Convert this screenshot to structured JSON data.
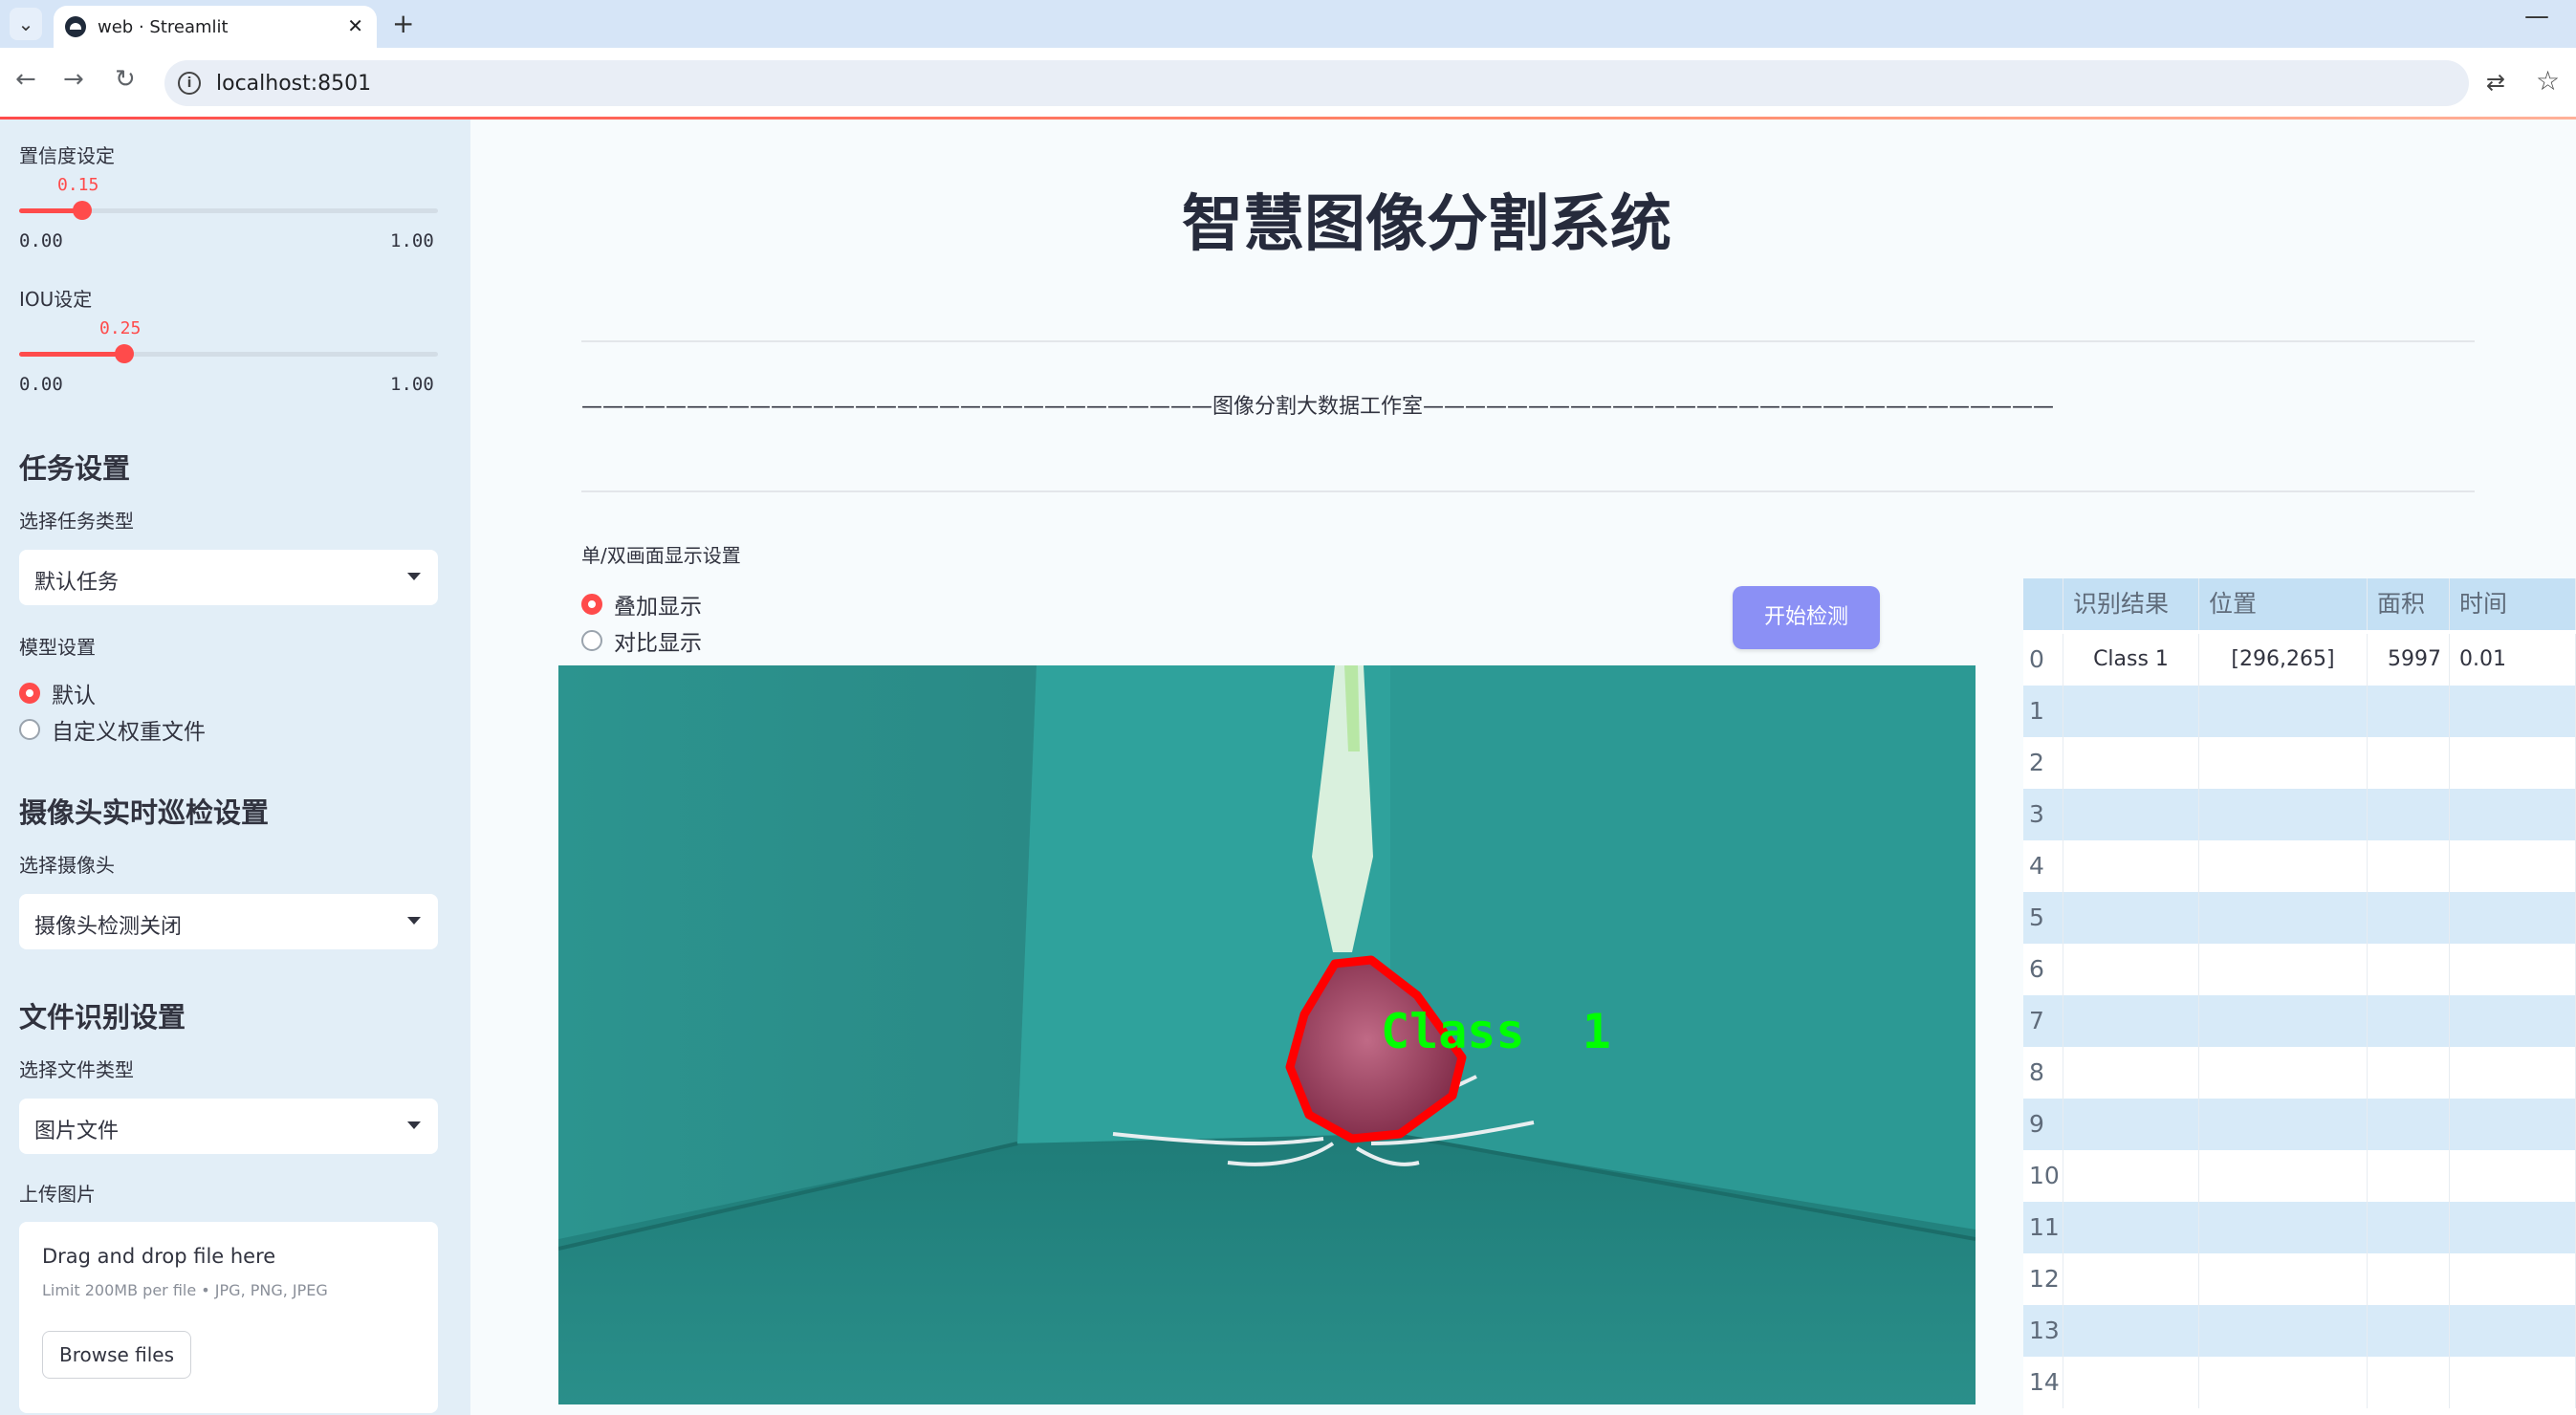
{
  "browser": {
    "tab_title": "web · Streamlit",
    "tab_close": "✕",
    "new_tab": "+",
    "minimize": "—",
    "url": "localhost:8501"
  },
  "sidebar": {
    "confidence": {
      "label": "置信度设定",
      "value": "0.15",
      "value_fraction": 0.15,
      "min": "0.00",
      "max": "1.00"
    },
    "iou": {
      "label": "IOU设定",
      "value": "0.25",
      "value_fraction": 0.25,
      "min": "0.00",
      "max": "1.00"
    },
    "task_heading": "任务设置",
    "task_type_label": "选择任务类型",
    "task_type_value": "默认任务",
    "model_label": "模型设置",
    "model_options": [
      "默认",
      "自定义权重文件"
    ],
    "model_selected": "默认",
    "camera_heading": "摄像头实时巡检设置",
    "camera_label": "选择摄像头",
    "camera_value": "摄像头检测关闭",
    "file_heading": "文件识别设置",
    "file_type_label": "选择文件类型",
    "file_type_value": "图片文件",
    "upload_label": "上传图片",
    "upload": {
      "title": "Drag and drop file here",
      "subtitle": "Limit 200MB per file • JPG, PNG, JPEG",
      "button": "Browse files"
    }
  },
  "main": {
    "title": "智慧图像分割系统",
    "studio_line": "——————————————————————————————图像分割大数据工作室——————————————————————————————",
    "display_mode_label": "单/双画面显示设置",
    "display_options": [
      "叠加显示",
      "对比显示"
    ],
    "display_selected": "叠加显示",
    "start_button": "开始检测",
    "detection_label": "Class  1"
  },
  "results_table": {
    "columns": [
      "",
      "识别结果",
      "位置",
      "面积",
      "时间"
    ],
    "rows": [
      [
        "0",
        "Class  1",
        "[296,265]",
        "5997",
        "0.01"
      ],
      [
        "1",
        "",
        "",
        "",
        ""
      ],
      [
        "2",
        "",
        "",
        "",
        ""
      ],
      [
        "3",
        "",
        "",
        "",
        ""
      ],
      [
        "4",
        "",
        "",
        "",
        ""
      ],
      [
        "5",
        "",
        "",
        "",
        ""
      ],
      [
        "6",
        "",
        "",
        "",
        ""
      ],
      [
        "7",
        "",
        "",
        "",
        ""
      ],
      [
        "8",
        "",
        "",
        "",
        ""
      ],
      [
        "9",
        "",
        "",
        "",
        ""
      ],
      [
        "10",
        "",
        "",
        "",
        ""
      ],
      [
        "11",
        "",
        "",
        "",
        ""
      ],
      [
        "12",
        "",
        "",
        "",
        ""
      ],
      [
        "13",
        "",
        "",
        "",
        ""
      ],
      [
        "14",
        "",
        "",
        "",
        ""
      ]
    ]
  },
  "colors": {
    "accent": "#ff4b4b",
    "sidebar_bg": "#e2eef7",
    "button_bg": "#8b90f5",
    "table_header": "#c4e0f4",
    "table_stripe": "#d7eaf8",
    "mask": "#ff0000",
    "label_green": "#00ff00"
  }
}
